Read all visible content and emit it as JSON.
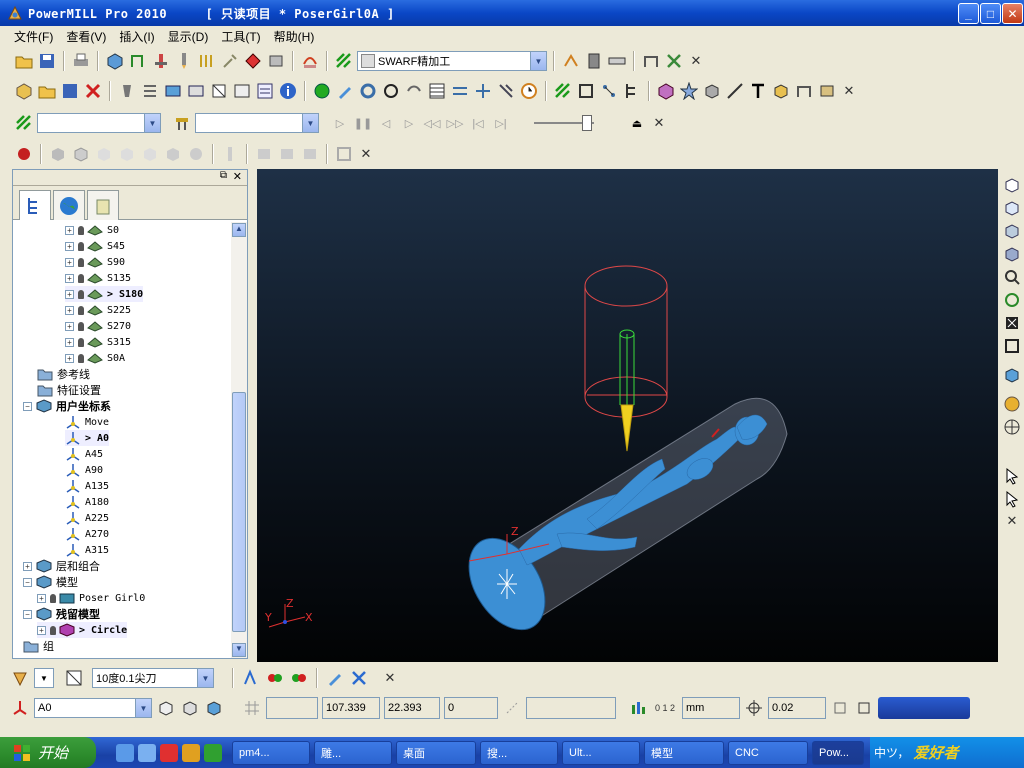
{
  "window": {
    "title": "PowerMILL Pro 2010     [ 只读项目 * PoserGirl0A ]"
  },
  "menu": [
    "文件(F)",
    "查看(V)",
    "插入(I)",
    "显示(D)",
    "工具(T)",
    "帮助(H)"
  ],
  "toolbar1": {
    "strategy_label": "SWARF精加工"
  },
  "explorer": {
    "rows": [
      {
        "label": "S0",
        "indent": 2,
        "kind": "item"
      },
      {
        "label": "S45",
        "indent": 2,
        "kind": "item"
      },
      {
        "label": "S90",
        "indent": 2,
        "kind": "item"
      },
      {
        "label": "S135",
        "indent": 2,
        "kind": "item"
      },
      {
        "label": "> S180",
        "indent": 2,
        "kind": "item",
        "active": true
      },
      {
        "label": "S225",
        "indent": 2,
        "kind": "item"
      },
      {
        "label": "S270",
        "indent": 2,
        "kind": "item"
      },
      {
        "label": "S315",
        "indent": 2,
        "kind": "item"
      },
      {
        "label": "S0A",
        "indent": 2,
        "kind": "item"
      },
      {
        "label": "参考线",
        "indent": 1,
        "kind": "folder"
      },
      {
        "label": "特征设置",
        "indent": 1,
        "kind": "folder"
      },
      {
        "label": "用户坐标系",
        "indent": 0,
        "kind": "group",
        "bold": true
      },
      {
        "label": "Move",
        "indent": 2,
        "kind": "ucs"
      },
      {
        "label": "> A0",
        "indent": 2,
        "kind": "ucs",
        "active": true
      },
      {
        "label": "A45",
        "indent": 2,
        "kind": "ucs"
      },
      {
        "label": "A90",
        "indent": 2,
        "kind": "ucs"
      },
      {
        "label": "A135",
        "indent": 2,
        "kind": "ucs"
      },
      {
        "label": "A180",
        "indent": 2,
        "kind": "ucs"
      },
      {
        "label": "A225",
        "indent": 2,
        "kind": "ucs"
      },
      {
        "label": "A270",
        "indent": 2,
        "kind": "ucs"
      },
      {
        "label": "A315",
        "indent": 2,
        "kind": "ucs"
      },
      {
        "label": "层和组合",
        "indent": 0,
        "kind": "group"
      },
      {
        "label": "模型",
        "indent": 0,
        "kind": "group"
      },
      {
        "label": "Poser Girl0",
        "indent": 1,
        "kind": "model"
      },
      {
        "label": "残留模型",
        "indent": 0,
        "kind": "group",
        "bold": true
      },
      {
        "label": "> Circle",
        "indent": 1,
        "kind": "stock",
        "active": true
      },
      {
        "label": "组",
        "indent": 0,
        "kind": "folder"
      }
    ]
  },
  "bottom": {
    "tool": "10度0.1尖刀"
  },
  "status": {
    "workplane": "A0",
    "x": "107.339",
    "y": "22.393",
    "z": "0",
    "units": "mm",
    "tolerance": "0.02",
    "scale_label": "0 1 2"
  },
  "viewport": {
    "axis_labels": [
      "Y",
      "Z",
      "X"
    ],
    "ucs_label": "Z"
  },
  "taskbar": {
    "start": "开始",
    "tasks": [
      "pm4...",
      "雕...",
      "桌面",
      "搜...",
      "Ult...",
      "模型",
      "CNC",
      "Pow..."
    ],
    "tray": "中ツ，",
    "watermark": "爱好者"
  },
  "colors": {
    "title_blue": "#0a47c6",
    "viewport_top": "#1e3046",
    "model_blue": "#3c8fd4",
    "taskbar_blue": "#1941a5"
  }
}
